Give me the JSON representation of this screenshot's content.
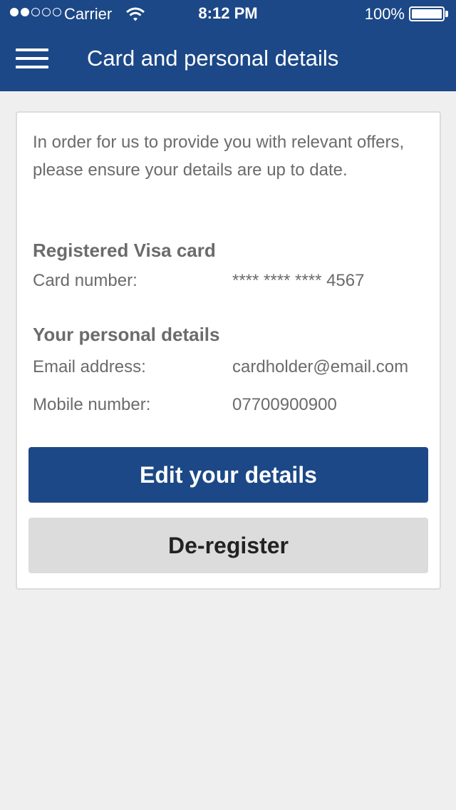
{
  "status_bar": {
    "carrier": "Carrier",
    "time": "8:12 PM",
    "battery": "100%",
    "signal_strength": 2,
    "signal_max": 5
  },
  "header": {
    "title": "Card and personal details",
    "menu_icon": "hamburger-menu-icon",
    "background_color": "#1c4887"
  },
  "card": {
    "intro": "In order for us to provide you with relevant offers, please ensure your details are up to date.",
    "registered_heading": "Registered  Visa card",
    "card_number_label": "Card number:",
    "card_number_value": "**** **** **** 4567",
    "personal_heading": "Your personal details",
    "email_label": "Email address:",
    "email_value": "cardholder@email.com",
    "mobile_label": "Mobile number:",
    "mobile_value": "07700900900"
  },
  "actions": {
    "edit_label": "Edit your details",
    "deregister_label": "De-register",
    "primary_color": "#1c4887"
  }
}
